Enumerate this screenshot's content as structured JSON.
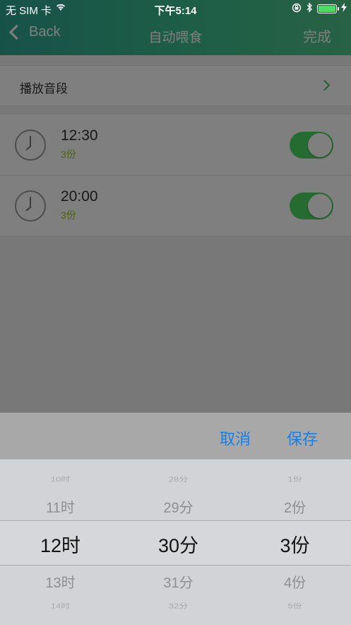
{
  "status_bar": {
    "carrier": "无 SIM 卡",
    "time": "下午5:14"
  },
  "nav": {
    "back_label": "Back",
    "title": "自动喂食",
    "done_label": "完成"
  },
  "sound_row": {
    "label": "播放音段"
  },
  "alarms": [
    {
      "time": "12:30",
      "portion": "3份",
      "enabled": true
    },
    {
      "time": "20:00",
      "portion": "3份",
      "enabled": true
    }
  ],
  "picker": {
    "cancel_label": "取消",
    "save_label": "保存",
    "hours": {
      "far_above": "10时",
      "above": "11时",
      "selected": "12时",
      "below": "13时",
      "far_below": "14时"
    },
    "minutes": {
      "far_above": "28分",
      "above": "29分",
      "selected": "30分",
      "below": "31分",
      "far_below": "32分"
    },
    "portions": {
      "far_above": "1份",
      "above": "2份",
      "selected": "3份",
      "below": "4份",
      "far_below": "5份"
    }
  },
  "colors": {
    "accent_green": "#4cd964",
    "link_blue": "#1b7fe0",
    "portion_text": "#9bbf2f"
  }
}
